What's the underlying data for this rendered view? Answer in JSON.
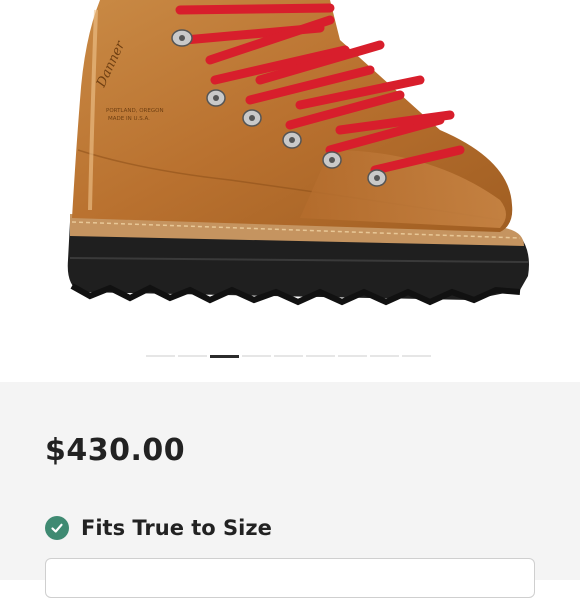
{
  "product": {
    "image_icon": "hiking-boot-photo",
    "price": "$430.00",
    "fit_label": "Fits True to Size",
    "fit_icon": "check-circle-icon"
  },
  "gallery": {
    "page_count": 9,
    "active_index": 2
  },
  "colors": {
    "accent_green": "#3f8a72",
    "lace_red": "#d81e2c",
    "leather_tan": "#b9712f"
  }
}
